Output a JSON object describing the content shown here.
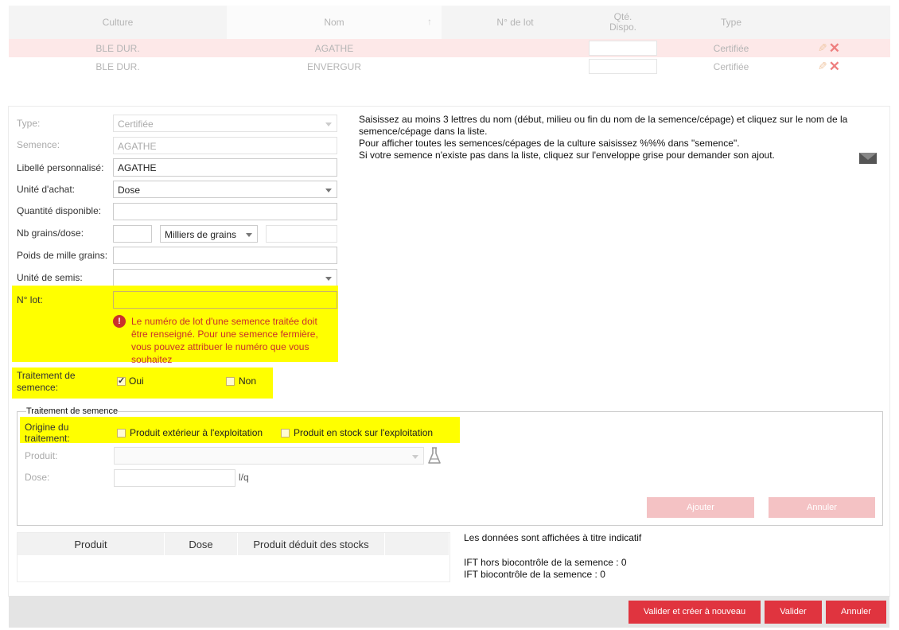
{
  "table": {
    "headers": {
      "culture": "Culture",
      "nom": "Nom",
      "lot": "N° de lot",
      "qte": "Qté. Dispo.",
      "type": "Type"
    },
    "sort_arrow": "↑",
    "rows": [
      {
        "culture": "BLE DUR.",
        "nom": "AGATHE",
        "lot": "",
        "qte": "",
        "type": "Certifiée"
      },
      {
        "culture": "BLE DUR.",
        "nom": "ENVERGUR",
        "lot": "",
        "qte": "",
        "type": "Certifiée"
      }
    ]
  },
  "form": {
    "type_label": "Type:",
    "type_value": "Certifiée",
    "semence_label": "Semence:",
    "semence_value": "AGATHE",
    "libelle_label": "Libellé personnalisé:",
    "libelle_value": "AGATHE",
    "unite_achat_label": "Unité d'achat:",
    "unite_achat_value": "Dose",
    "quantite_label": "Quantité disponible:",
    "quantite_value": "",
    "nb_grains_label": "Nb grains/dose:",
    "nb_grains_value": "",
    "nb_grains_unit": "Milliers de grains",
    "nb_grains_extra": "",
    "pmg_label": "Poids de mille grains:",
    "pmg_value": "",
    "unite_semis_label": "Unité de semis:",
    "unite_semis_value": "",
    "lot_label": "N° lot:",
    "lot_value": "",
    "lot_error": "Le numéro de lot d'une semence traitée doit être renseigné. Pour une semence fermière, vous pouvez attribuer le numéro que vous souhaitez",
    "traitement_label": "Traitement de semence:",
    "traitement_oui": "Oui",
    "traitement_non": "Non",
    "traitement_oui_checked": true,
    "traitement_non_checked": false
  },
  "info": {
    "line1": "Saisissez au moins 3 lettres du nom (début, milieu ou fin du nom de la semence/cépage) et cliquez sur le nom de la semence/cépage dans la liste.",
    "line2": "Pour afficher toutes les semences/cépages de la culture saisissez %%% dans \"semence\".",
    "line3": "Si votre semence n'existe pas dans la liste, cliquez sur l'enveloppe grise pour demander son ajout."
  },
  "traitement_section": {
    "legend": "Traitement de semence",
    "origine_label": "Origine du traitement:",
    "option_exterieur": "Produit extérieur à l'exploitation",
    "option_stock": "Produit en stock sur l'exploitation",
    "produit_label": "Produit:",
    "produit_value": "",
    "dose_label": "Dose:",
    "dose_value": "",
    "dose_unit": "l/q",
    "ajouter": "Ajouter",
    "annuler": "Annuler"
  },
  "products_table": {
    "headers": [
      "Produit",
      "Dose",
      "Produit déduit des stocks",
      ""
    ]
  },
  "ift": {
    "note": "Les données sont affichées à titre indicatif",
    "hors_bio": "IFT hors biocontrôle de la semence : 0",
    "bio": "IFT biocontrôle de la semence : 0"
  },
  "footer": {
    "valider_creer": "Valider et créer à nouveau",
    "valider": "Valider",
    "annuler": "Annuler"
  },
  "icons": {
    "pencil": "pencil-icon",
    "delete": "cross-icon",
    "envelope": "envelope-icon",
    "flask": "flask-icon",
    "error": "exclamation-icon"
  },
  "colors": {
    "primary_red": "#e0343f",
    "pale_red": "#f4c2c4",
    "highlight": "#ffff00",
    "selected_row": "#fde8e8",
    "error": "#c9302c"
  }
}
